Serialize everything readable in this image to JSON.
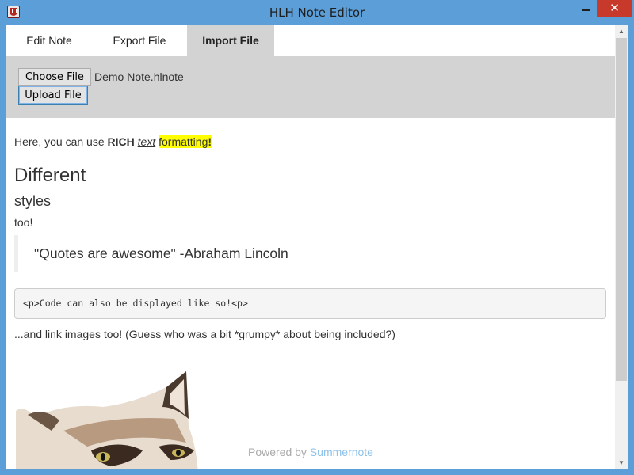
{
  "window": {
    "title": "HLH Note Editor",
    "minimize_glyph": "",
    "close_glyph": "✕",
    "app_icon": "shield-icon"
  },
  "tabs": [
    {
      "label": "Edit Note",
      "active": false
    },
    {
      "label": "Export File",
      "active": false
    },
    {
      "label": "Import File",
      "active": true
    }
  ],
  "import": {
    "choose_label": "Choose File",
    "file_name": "Demo Note.hlnote",
    "upload_label": "Upload File"
  },
  "content": {
    "intro_prefix": "Here, you can use ",
    "intro_rich": "RICH",
    "intro_space": " ",
    "intro_text": "text",
    "intro_space2": " ",
    "intro_formatting": "formatting",
    "intro_bang": "!",
    "heading_1": "Different",
    "heading_2": "styles",
    "too": "too!",
    "quote": "\"Quotes are awesome\" -Abraham Lincoln",
    "code": "<p>Code can also be displayed like so!<p>",
    "link_text": "...and link images too! (Guess who was a bit *grumpy* about being included?)",
    "image": "grumpy-cat-image"
  },
  "footer": {
    "powered_prefix": "Powered by ",
    "powered_link": "Summernote"
  },
  "colors": {
    "title_bar": "#5c9fd8",
    "close_button": "#c7392b",
    "tab_active_bg": "#d3d3d3",
    "highlight": "#ffff00",
    "link": "#8ec2ea"
  },
  "scroll": {
    "up_glyph": "▲",
    "down_glyph": "▼"
  }
}
